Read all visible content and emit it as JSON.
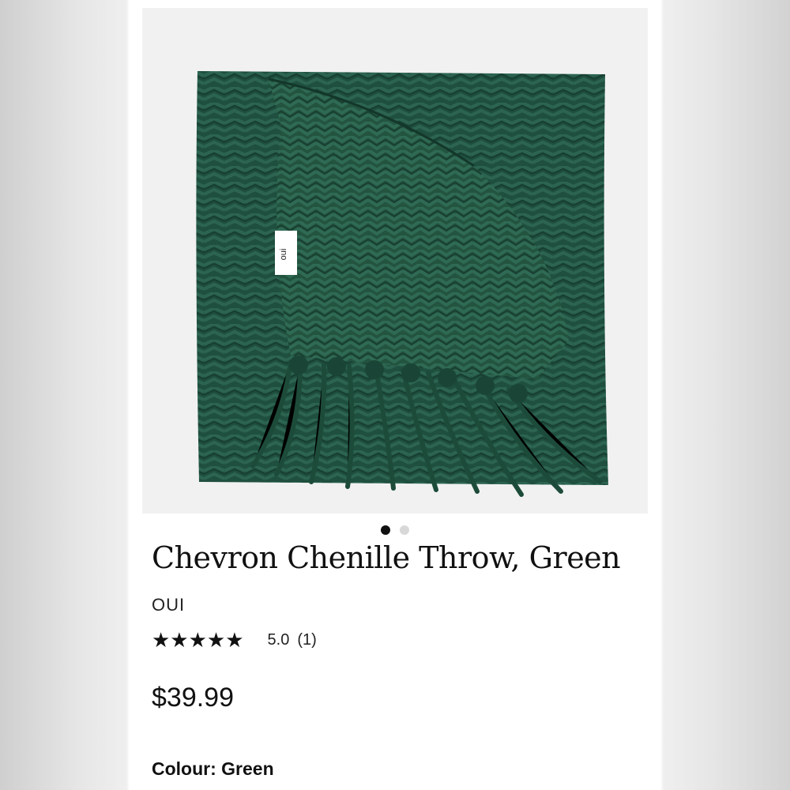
{
  "product": {
    "title": "Chevron Chenille Throw, Green",
    "brand": "OUI",
    "rating": {
      "stars_text": "★★★★★",
      "score": "5.0",
      "count": "(1)",
      "stars_filled": 5,
      "stars_total": 5
    },
    "price": "$39.99",
    "colour_label": "Colour:",
    "colour_value": "Green"
  },
  "gallery": {
    "image_count": 2,
    "active_index": 0,
    "tag_text": "oui",
    "image_icon": "folded-green-throw-blanket"
  },
  "colors": {
    "throw_green": "#1f4f3e",
    "throw_dark": "#163b2e",
    "image_background": "#f1f1f1",
    "dot_active": "#111111",
    "dot_inactive": "#d8d8d8"
  }
}
